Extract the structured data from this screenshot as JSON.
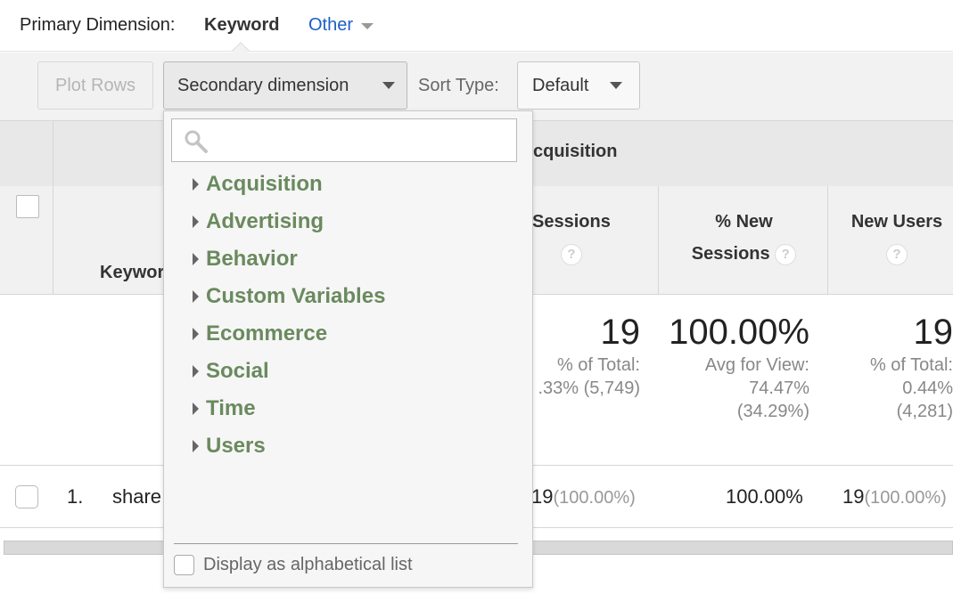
{
  "primary": {
    "label": "Primary Dimension:",
    "selected": "Keyword",
    "other": "Other"
  },
  "toolbar": {
    "plot_rows": "Plot Rows",
    "secondary_dimension": "Secondary dimension",
    "sort_type_label": "Sort Type:",
    "sort_type_value": "Default"
  },
  "table": {
    "group_title": "cquisition",
    "keyword_col": "Keywor",
    "sessions_col": "Sessions",
    "new_sessions_col_line1": "% New",
    "new_sessions_col_line2": "Sessions",
    "new_users_col": "New Users",
    "help_glyph": "?",
    "summary": {
      "sessions_total": "19",
      "sessions_sub1": "% of Total:",
      "sessions_sub2": ".33% (5,749)",
      "new_sessions_total": "100.00%",
      "new_sessions_sub1": "Avg for View:",
      "new_sessions_sub2": "74.47%",
      "new_sessions_sub3": "(34.29%)",
      "new_users_total": "19",
      "new_users_sub1": "% of Total:",
      "new_users_sub2": "0.44%",
      "new_users_sub3": "(4,281)"
    },
    "rows": [
      {
        "num": "1.",
        "keyword": "share",
        "sessions": "19",
        "sessions_pct": "(100.00%)",
        "new_sessions": "100.00%",
        "new_users": "19",
        "new_users_pct": "(100.00%)"
      }
    ]
  },
  "dropdown": {
    "search_placeholder": "",
    "categories": [
      "Acquisition",
      "Advertising",
      "Behavior",
      "Custom Variables",
      "Ecommerce",
      "Social",
      "Time",
      "Users"
    ],
    "alphabetical_label": "Display as alphabetical list"
  },
  "colors": {
    "category_text": "#6a8a5e",
    "link_blue": "#1a5fc5"
  }
}
